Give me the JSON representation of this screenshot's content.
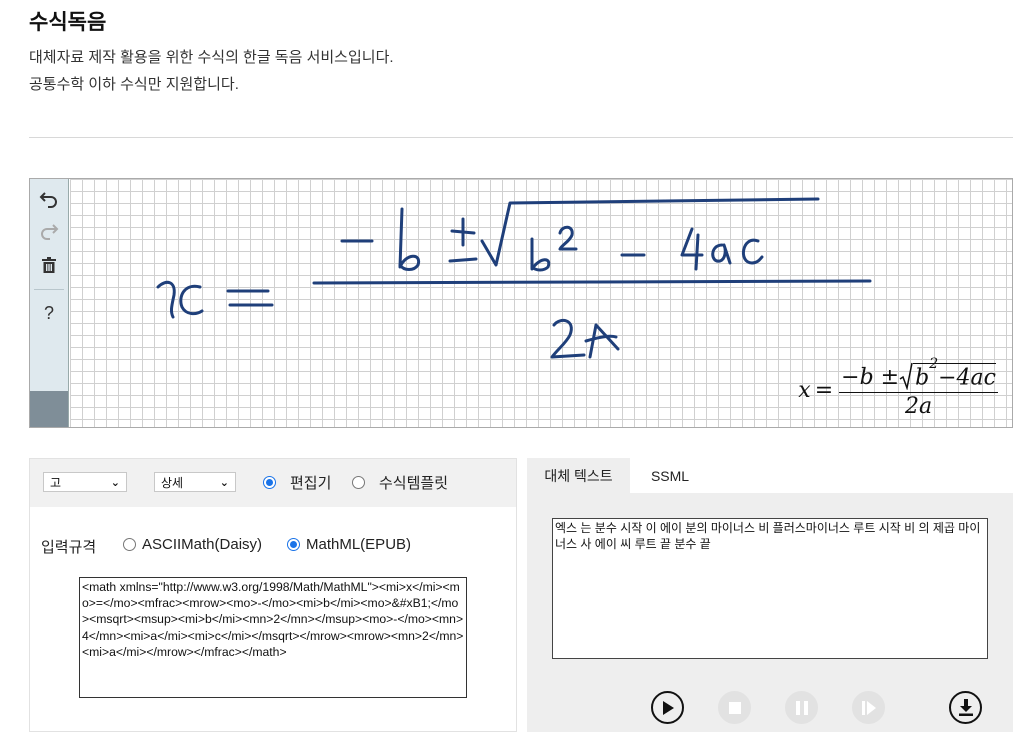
{
  "page": {
    "title": "수식독음",
    "desc1": "대체자료 제작 활용을 위한 수식의 한글 독음 서비스입니다.",
    "desc2": "공통수학 이하 수식만 지원합니다."
  },
  "toolbar": {
    "undo_icon": "undo-icon",
    "redo_icon": "redo-icon",
    "trash_icon": "trash-icon",
    "help_label": "?"
  },
  "formula": {
    "x": "x",
    "eq": "=",
    "minus_b": "−b ±",
    "radicand_b": "b",
    "exp": "2",
    "radicand_rest": "−4ac",
    "den": "2a"
  },
  "controls": {
    "level_select": "고",
    "detail_select": "상세",
    "mode_editor": "편집기",
    "mode_template": "수식템플릿",
    "mode_selected": "편집기",
    "input_label": "입력규격",
    "input_ascii": "ASCIIMath(Daisy)",
    "input_mathml": "MathML(EPUB)",
    "input_selected": "MathML(EPUB)",
    "code": "<math xmlns=\"http://www.w3.org/1998/Math/MathML\"><mi>x</mi><mo>=</mo><mfrac><mrow><mo>-</mo><mi>b</mi><mo>&#xB1;</mo><msqrt><msup><mi>b</mi><mn>2</mn></msup><mo>-</mo><mn>4</mn><mi>a</mi><mi>c</mi></msqrt></mrow><mrow><mn>2</mn><mi>a</mi></mrow></mfrac></math>"
  },
  "output": {
    "tab_alt": "대체 텍스트",
    "tab_ssml": "SSML",
    "active_tab": "대체 텍스트",
    "alt_text": "엑스 는 분수 시작 이 에이 분의 마이너스 비 플러스마이너스 루트 시작 비 의 제곱 마이너스 사 에이 씨 루트 끝 분수 끝"
  },
  "colors": {
    "ink": "#1f3f7a",
    "accent": "#1a73e8",
    "toolbar_bg": "#dfe9ee"
  }
}
